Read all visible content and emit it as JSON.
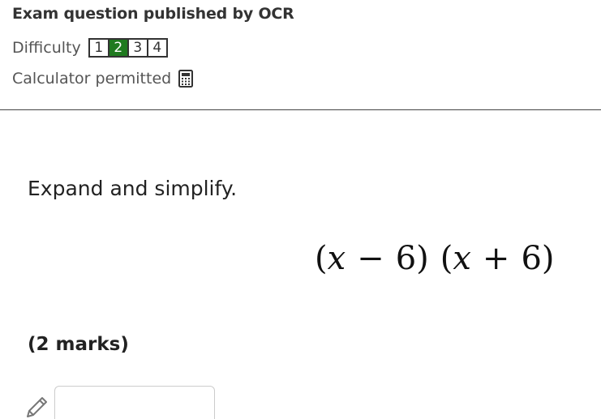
{
  "header": {
    "title": "Exam question published by OCR"
  },
  "difficulty": {
    "label": "Difficulty",
    "levels": [
      "1",
      "2",
      "3",
      "4"
    ],
    "selected": "2"
  },
  "calculator": {
    "label": "Calculator permitted",
    "icon": "calculator-icon"
  },
  "question": {
    "instruction": "Expand and simplify.",
    "expression": {
      "open1": "(",
      "var1": "x",
      "op1": "−",
      "num1": "6",
      "close1": ")",
      "open2": "(",
      "var2": "x",
      "op2": "+",
      "num2": "6",
      "close2": ")"
    },
    "marks": "(2 marks)"
  },
  "answer": {
    "icon": "pencil-icon",
    "value": ""
  },
  "colors": {
    "difficulty_active": "#1f7a1f",
    "text": "#222222",
    "muted": "#555555"
  }
}
